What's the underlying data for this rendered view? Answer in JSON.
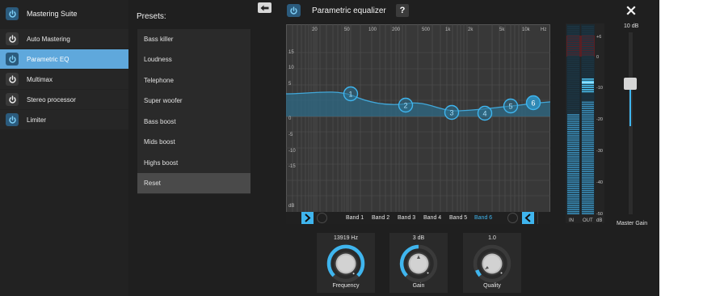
{
  "sidebar": {
    "title": "Mastering Suite",
    "items": [
      {
        "label": "Auto Mastering",
        "on": false
      },
      {
        "label": "Parametric EQ",
        "on": true,
        "selected": true
      },
      {
        "label": "Multimax",
        "on": false
      },
      {
        "label": "Stereo processor",
        "on": false
      },
      {
        "label": "Limiter",
        "on": true
      }
    ]
  },
  "presets": {
    "label": "Presets:",
    "items": [
      "Bass killer",
      "Loudness",
      "Telephone",
      "Super woofer",
      "Bass boost",
      "Mids boost",
      "Highs boost",
      "Reset"
    ],
    "selected_index": 7
  },
  "eq": {
    "title": "Parametric equalizer",
    "help_label": "?",
    "freq_ticks": [
      "20",
      "50",
      "100",
      "200",
      "500",
      "1k",
      "2k",
      "5k",
      "10k",
      "Hz"
    ],
    "db_ticks": [
      "15",
      "10",
      "5",
      "0",
      "-5",
      "-10",
      "-15",
      "dB"
    ],
    "bands": [
      "Band 1",
      "Band 2",
      "Band 3",
      "Band 4",
      "Band 5",
      "Band 6"
    ],
    "active_band": 5,
    "nodes": [
      "1",
      "2",
      "3",
      "4",
      "5",
      "6"
    ]
  },
  "meter": {
    "scale": [
      "+6",
      "0",
      "-10",
      "-20",
      "-30",
      "-40",
      "-50"
    ],
    "in_label": "IN",
    "out_label": "OUT",
    "db_label": "dB"
  },
  "master": {
    "value": "10 dB",
    "label": "Master Gain"
  },
  "knobs": [
    {
      "value": "13919 Hz",
      "label": "Frequency"
    },
    {
      "value": "3 dB",
      "label": "Gain"
    },
    {
      "value": "1.0",
      "label": "Quality"
    }
  ],
  "colors": {
    "accent": "#3fb5ee",
    "selected_item": "#5fa8dc",
    "background": "#1f1f1f"
  }
}
